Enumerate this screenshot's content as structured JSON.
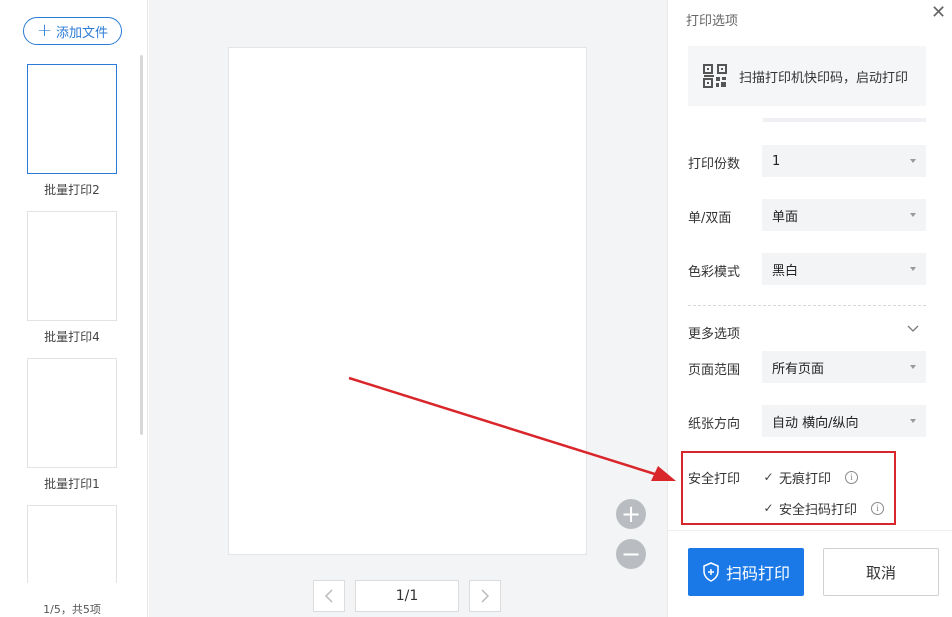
{
  "sidebar": {
    "add_button_label": "添加文件",
    "files": [
      {
        "label": "批量打印2"
      },
      {
        "label": "批量打印4"
      },
      {
        "label": "批量打印1"
      },
      {
        "label": ""
      }
    ],
    "count_text": "1/5，共5项"
  },
  "preview": {
    "page_indicator": "1/1",
    "zoom_in_label": "+",
    "zoom_out_label": "−"
  },
  "panel": {
    "title": "打印选项",
    "qr_banner_text": "扫描打印机快印码，启动打印",
    "copies_label": "打印份数",
    "copies_value": "1",
    "duplex_label": "单/双面",
    "duplex_value": "单面",
    "color_label": "色彩模式",
    "color_value": "黑白",
    "more_label": "更多选项",
    "range_label": "页面范围",
    "range_value": "所有页面",
    "orientation_label": "纸张方向",
    "orientation_value": "自动 横向/纵向",
    "secure_label": "安全打印",
    "option_traceless": "无痕打印",
    "option_secure_scan": "安全扫码打印",
    "primary_button": "扫码打印",
    "cancel_button": "取消"
  },
  "colors": {
    "accent": "#1a79e6",
    "highlight_red": "#d8262b"
  }
}
